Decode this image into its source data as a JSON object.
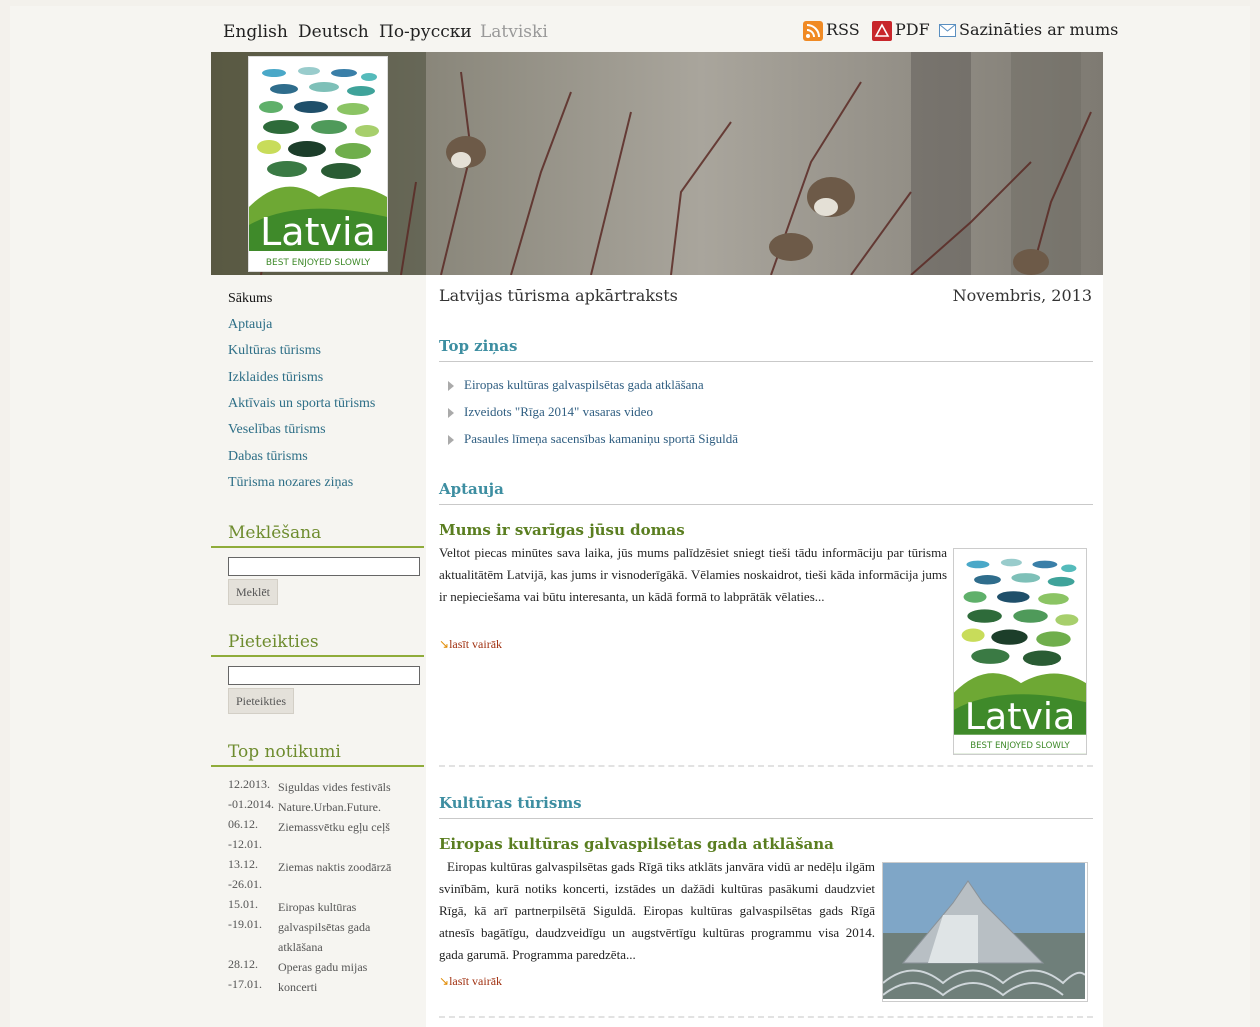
{
  "languages": [
    {
      "label": "English",
      "active": false
    },
    {
      "label": "Deutsch",
      "active": false
    },
    {
      "label": "По-русски",
      "active": false
    },
    {
      "label": "Latviski",
      "active": true
    }
  ],
  "toplinks": {
    "rss": "RSS",
    "pdf": "PDF",
    "contact": "Sazināties ar mums"
  },
  "logo": {
    "word": "Latvia",
    "tagline": "BEST ENJOYED SLOWLY"
  },
  "sidebar": {
    "nav": [
      "Sākums",
      "Aptauja",
      "Kultūras tūrisms",
      "Izklaides tūrisms",
      "Aktīvais un sporta tūrisms",
      "Veselības tūrisms",
      "Dabas tūrisms",
      "Tūrisma nozares ziņas"
    ],
    "search_heading": "Meklēšana",
    "search_button": "Meklēt",
    "subscribe_heading": "Pieteikties",
    "subscribe_button": "Pieteikties",
    "events_heading": "Top notikumi",
    "events": [
      {
        "date": "12.2013.",
        "title": "Siguldas vides festivāls"
      },
      {
        "date": "-01.2014.",
        "title": "Nature.Urban.Future."
      },
      {
        "date": "06.12.",
        "title": "Ziemassvētku egļu ceļš"
      },
      {
        "date": "-12.01.",
        "title": ""
      },
      {
        "date": "13.12.",
        "title": "Ziemas naktis zoodārzā"
      },
      {
        "date": "-26.01.",
        "title": ""
      },
      {
        "date": "15.01.",
        "title": "Eiropas kultūras"
      },
      {
        "date": "-19.01.",
        "title": "galvaspilsētas gada"
      },
      {
        "date": "",
        "title": "atklāšana"
      },
      {
        "date": "28.12.",
        "title": "Operas gadu mijas"
      },
      {
        "date": "-17.01.",
        "title": "koncerti"
      }
    ]
  },
  "main": {
    "title": "Latvijas tūrisma apkārtraksts",
    "date": "Novembris, 2013",
    "top_heading": "Top ziņas",
    "top_news": [
      "Eiropas kultūras galvaspilsētas gada atklāšana",
      "Izveidots \"Rīga 2014\" vasaras video",
      "Pasaules līmeņa sacensības kamaniņu sportā Siguldā"
    ],
    "survey_heading": "Aptauja",
    "survey_title": "Mums ir svarīgas jūsu domas",
    "survey_text": "Veltot piecas minūtes sava laika, jūs mums palīdzēsiet sniegt tieši tādu informāciju par tūrisma aktualitātēm Latvijā, kas jums ir visnoderīgākā. Vēlamies noskaidrot, tieši kāda informācija jums ir nepieciešama vai būtu interesanta, un kādā formā to labprātāk vēlaties...",
    "read_more": "lasīt vairāk",
    "culture_heading": "Kultūras tūrisms",
    "culture_title": "Eiropas kultūras galvaspilsētas gada atklāšana",
    "culture_text": "Eiropas kultūras galvaspilsētas gads Rīgā tiks atklāts janvāra vidū ar nedēļu ilgām svinībām, kurā notiks koncerti, izstādes un dažādi kultūras pasākumi daudzviet Rīgā, kā arī partnerpilsētā Siguldā. Eiropas kultūras galvaspilsētas gads Rīgā atnesīs bagātīgu, daudzveidīgu un augstvērtīgu kultūras programmu visa 2014. gada garumā. Programma paredzēta..."
  }
}
